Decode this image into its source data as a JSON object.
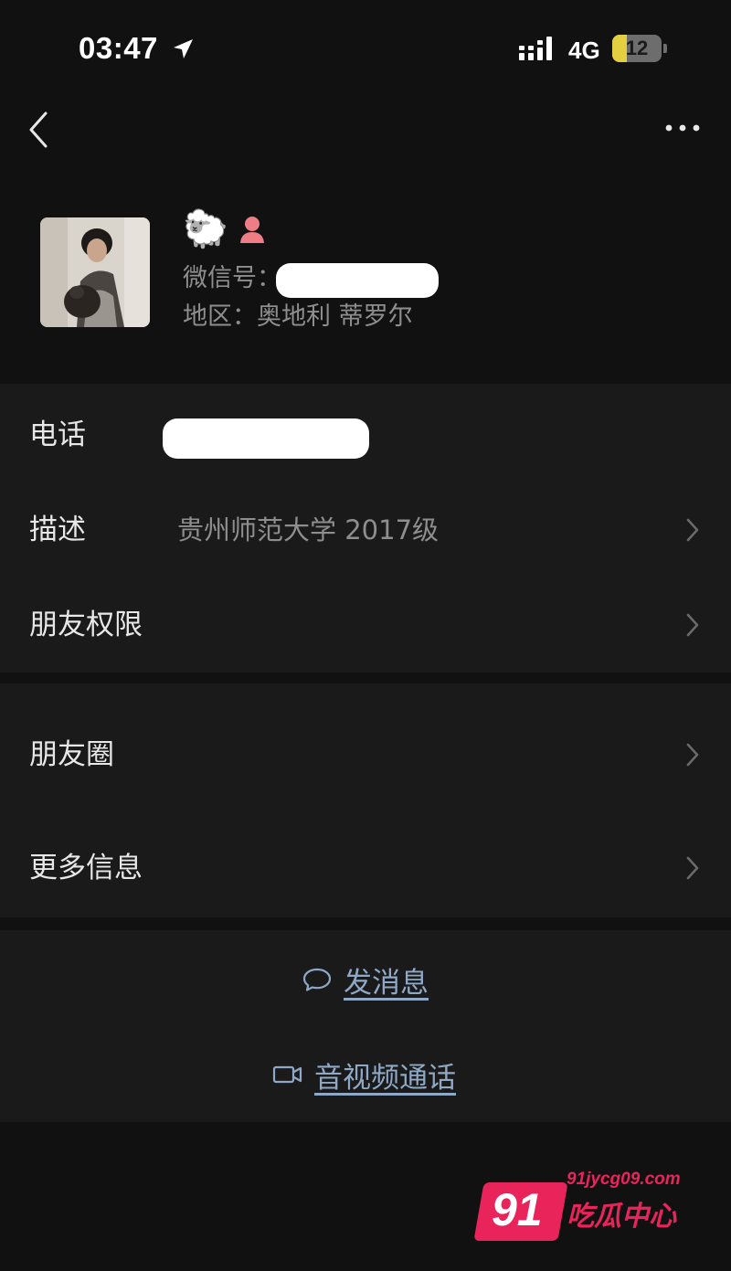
{
  "status_bar": {
    "time": "03:47",
    "network": "4G",
    "battery": "12",
    "battery_level": 0.12,
    "battery_color": "#e3cf3f",
    "icons": [
      "location-arrow-icon",
      "signal-bars-icon",
      "battery-icon"
    ]
  },
  "nav": {
    "back_icon": "chevron-left-icon",
    "more_icon": "ellipsis-icon"
  },
  "profile": {
    "emoji": "🐑",
    "gender_icon": "female-icon",
    "wechat_id_label": "微信号：",
    "region_label": "地区：",
    "region_value": "奥地利 蒂罗尔"
  },
  "rows": {
    "phone": {
      "label": "电话"
    },
    "description": {
      "label": "描述",
      "value": "贵州师范大学 2017级"
    },
    "friend_permissions": {
      "label": "朋友权限"
    },
    "moments": {
      "label": "朋友圈"
    },
    "more_info": {
      "label": "更多信息"
    }
  },
  "actions": {
    "send_message": {
      "label": "发消息",
      "icon": "chat-bubble-icon"
    },
    "video_call": {
      "label": "音视频通话",
      "icon": "video-camera-icon"
    },
    "link_color": "#8fa8c6"
  },
  "watermark": {
    "badge": "91",
    "url": "91jycg09.com",
    "name": "吃瓜中心",
    "color": "#e8245b"
  }
}
